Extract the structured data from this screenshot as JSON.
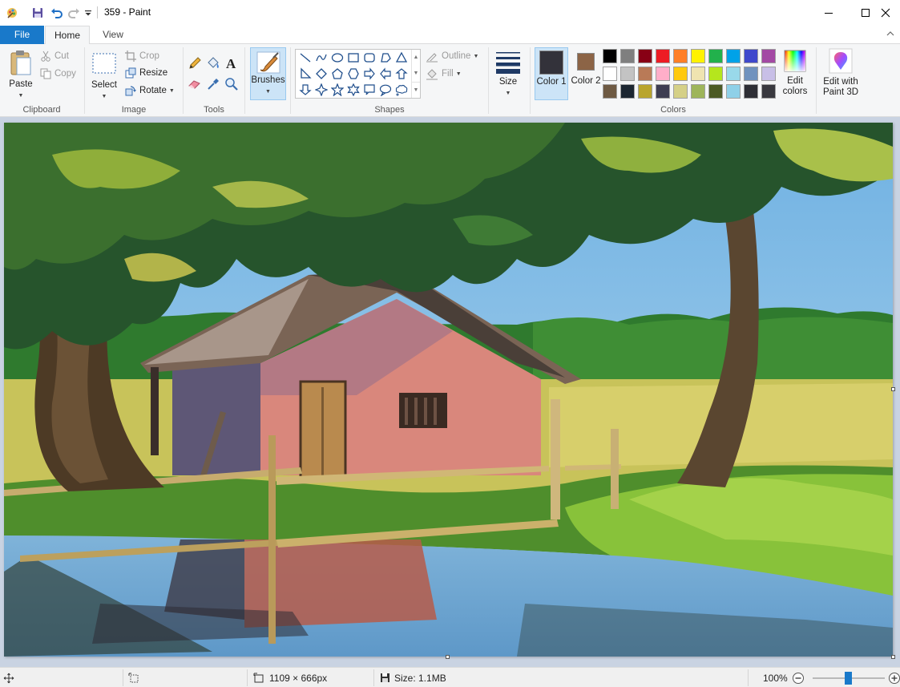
{
  "window": {
    "title": "359 - Paint",
    "controls": {
      "minimize": "minimize-icon",
      "maximize": "maximize-icon",
      "close": "close-icon"
    }
  },
  "quick_access": [
    "app-icon",
    "save-icon",
    "undo-icon",
    "redo-icon",
    "customize-icon"
  ],
  "tabs": [
    {
      "label": "File",
      "active": false
    },
    {
      "label": "Home",
      "active": true
    },
    {
      "label": "View",
      "active": false
    }
  ],
  "ribbon": {
    "clipboard": {
      "group_label": "Clipboard",
      "paste": "Paste",
      "cut": "Cut",
      "copy": "Copy"
    },
    "image": {
      "group_label": "Image",
      "select": "Select",
      "crop": "Crop",
      "resize": "Resize",
      "rotate": "Rotate"
    },
    "tools": {
      "group_label": "Tools",
      "items": [
        "pencil-icon",
        "fill-icon",
        "text-icon",
        "eraser-icon",
        "color-picker-icon",
        "magnifier-icon"
      ]
    },
    "brushes": {
      "label": "Brushes"
    },
    "shapes": {
      "group_label": "Shapes",
      "outline": "Outline",
      "fill": "Fill",
      "items": [
        "line",
        "curve",
        "oval",
        "rectangle",
        "rounded-rectangle",
        "polygon",
        "triangle",
        "right-triangle",
        "diamond",
        "pentagon",
        "hexagon",
        "arrow-right",
        "arrow-left",
        "arrow-up",
        "arrow-down",
        "star-four",
        "star-five",
        "star-six",
        "callout-rect",
        "callout-oval",
        "callout-cloud"
      ]
    },
    "size": {
      "label": "Size"
    },
    "colors": {
      "group_label": "Colors",
      "color1_label": "Color 1",
      "color1_value": "#33323a",
      "color2_label": "Color 2",
      "color2_value": "#8c6446",
      "edit_colors": "Edit colors",
      "palette": [
        "#000000",
        "#7f7f7f",
        "#880015",
        "#ed1c24",
        "#ff7f27",
        "#fff200",
        "#22b14c",
        "#00a2e8",
        "#3f48cc",
        "#a349a4",
        "#ffffff",
        "#c3c3c3",
        "#b97a57",
        "#ffaec9",
        "#ffc90e",
        "#efe4b0",
        "#b5e61d",
        "#99d9ea",
        "#7092be",
        "#c8bfe7",
        "#6e5a43",
        "#1c2631",
        "#b9a52e",
        "#3e3e52",
        "#d5d087",
        "#9eb55b",
        "#4c5a25",
        "#8fd0e8",
        "#2e2e35",
        "#39393f"
      ]
    },
    "paint3d": {
      "label": "Edit with Paint 3D"
    }
  },
  "status": {
    "canvas_size": "1109 × 666px",
    "file_size": "Size: 1.1MB",
    "zoom": "100%",
    "zoom_level_fraction": 0.5
  }
}
